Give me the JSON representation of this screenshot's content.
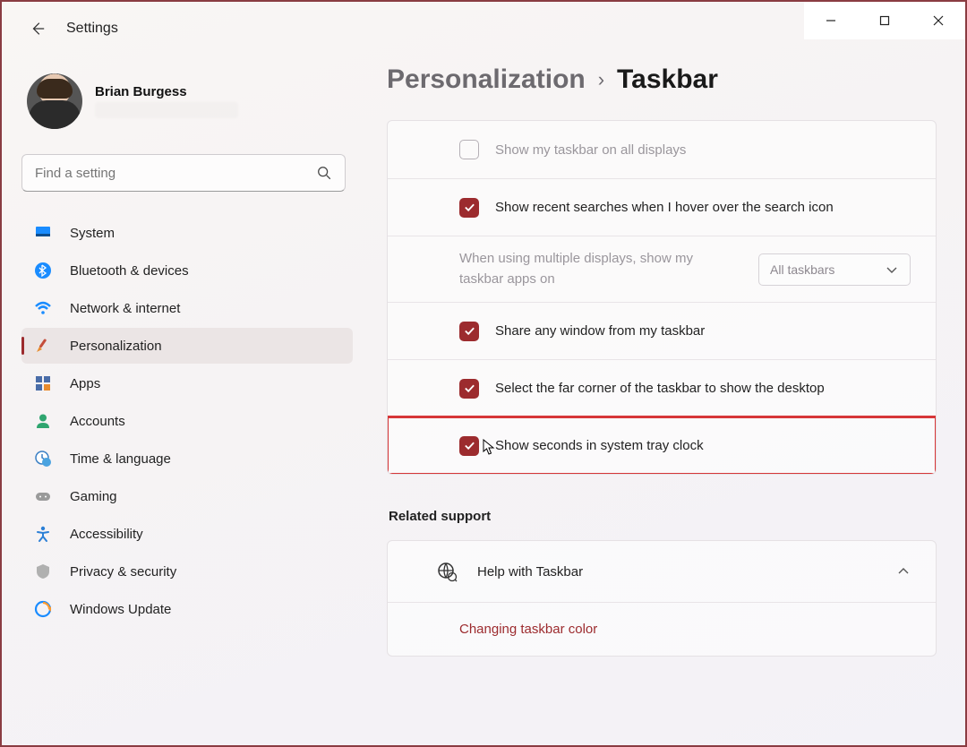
{
  "app": {
    "title": "Settings"
  },
  "profile": {
    "name": "Brian Burgess"
  },
  "search": {
    "placeholder": "Find a setting"
  },
  "sidebar": {
    "items": [
      {
        "label": "System"
      },
      {
        "label": "Bluetooth & devices"
      },
      {
        "label": "Network & internet"
      },
      {
        "label": "Personalization"
      },
      {
        "label": "Apps"
      },
      {
        "label": "Accounts"
      },
      {
        "label": "Time & language"
      },
      {
        "label": "Gaming"
      },
      {
        "label": "Accessibility"
      },
      {
        "label": "Privacy & security"
      },
      {
        "label": "Windows Update"
      }
    ]
  },
  "breadcrumb": {
    "parent": "Personalization",
    "current": "Taskbar"
  },
  "settings": {
    "show_all_displays": "Show my taskbar on all displays",
    "recent_searches": "Show recent searches when I hover over the search icon",
    "multi_display_label": "When using multiple displays, show my taskbar apps on",
    "multi_display_value": "All taskbars",
    "share_window": "Share any window from my taskbar",
    "far_corner": "Select the far corner of the taskbar to show the desktop",
    "show_seconds": "Show seconds in system tray clock"
  },
  "related": {
    "title": "Related support",
    "help": "Help with Taskbar",
    "link1": "Changing taskbar color"
  }
}
